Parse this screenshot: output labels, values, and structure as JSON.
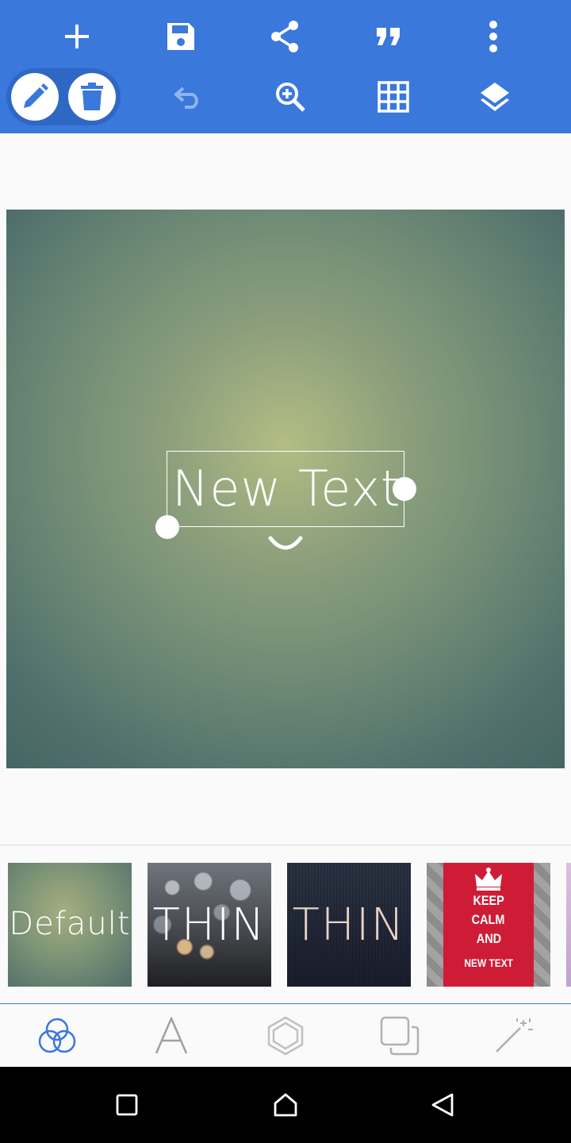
{
  "toolbar": {
    "background": "#3a78db",
    "icons_row1": [
      "add-icon",
      "save-icon",
      "share-icon",
      "quote-icon",
      "more-vert-icon"
    ],
    "icons_row2": [
      "edit-pencil-icon",
      "delete-trash-icon",
      "undo-icon",
      "zoom-in-icon",
      "grid-icon",
      "layers-icon"
    ]
  },
  "canvas": {
    "text_item": "New Text"
  },
  "templates": [
    {
      "label": "Default"
    },
    {
      "label": "THIN"
    },
    {
      "label": "THIN"
    },
    {
      "label_lines": [
        "KEEP",
        "CALM",
        "AND"
      ],
      "footer": "NEW TEXT"
    }
  ],
  "tabs": [
    "background-icon",
    "font-icon",
    "shape-icon",
    "layer-copy-icon",
    "effects-wand-icon"
  ],
  "nav": [
    "recents-icon",
    "home-icon",
    "back-icon"
  ]
}
